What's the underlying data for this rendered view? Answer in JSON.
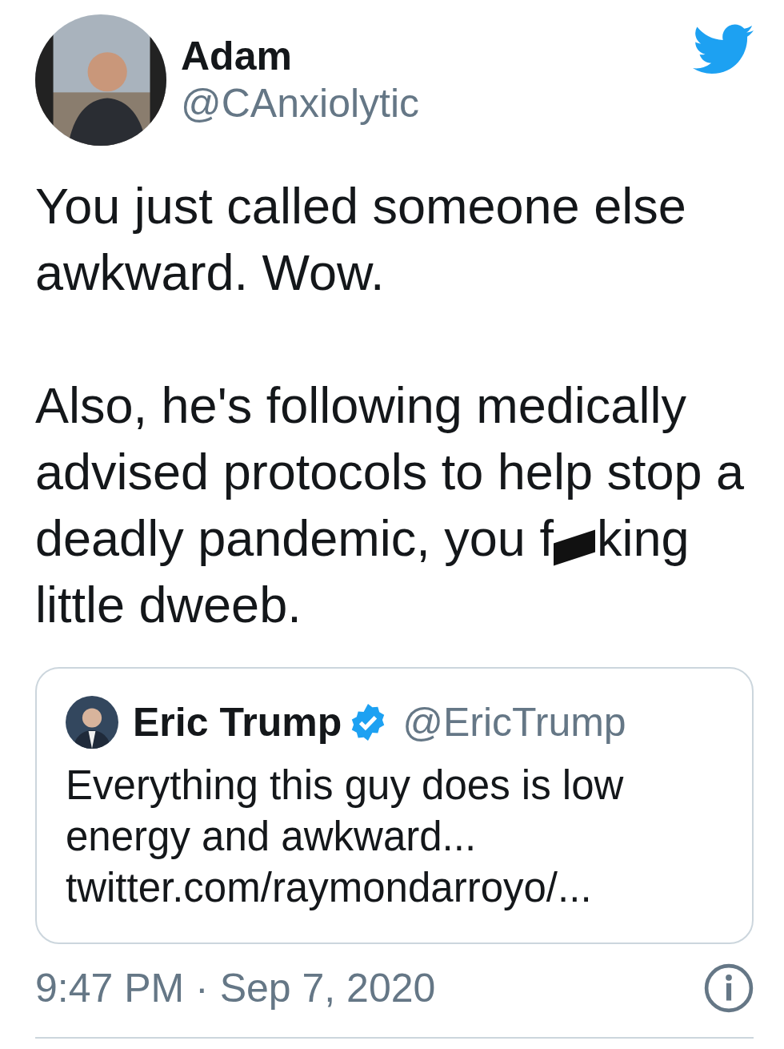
{
  "author": {
    "name": "Adam",
    "handle": "@CAnxiolytic"
  },
  "body": [
    {
      "text": "You just called someone else awkward. Wow."
    },
    {
      "text": "Also, he's following medically advised protocols to help stop a deadly pandemic, you f",
      "redacted": true,
      "after": "king little dweeb."
    }
  ],
  "quote": {
    "name": "Eric Trump",
    "verified": true,
    "handle": "@EricTrump",
    "text": "Everything this guy does is low energy and awkward...",
    "link": "twitter.com/raymondarroyo/..."
  },
  "timestamp": "9:47 PM · Sep 7, 2020"
}
